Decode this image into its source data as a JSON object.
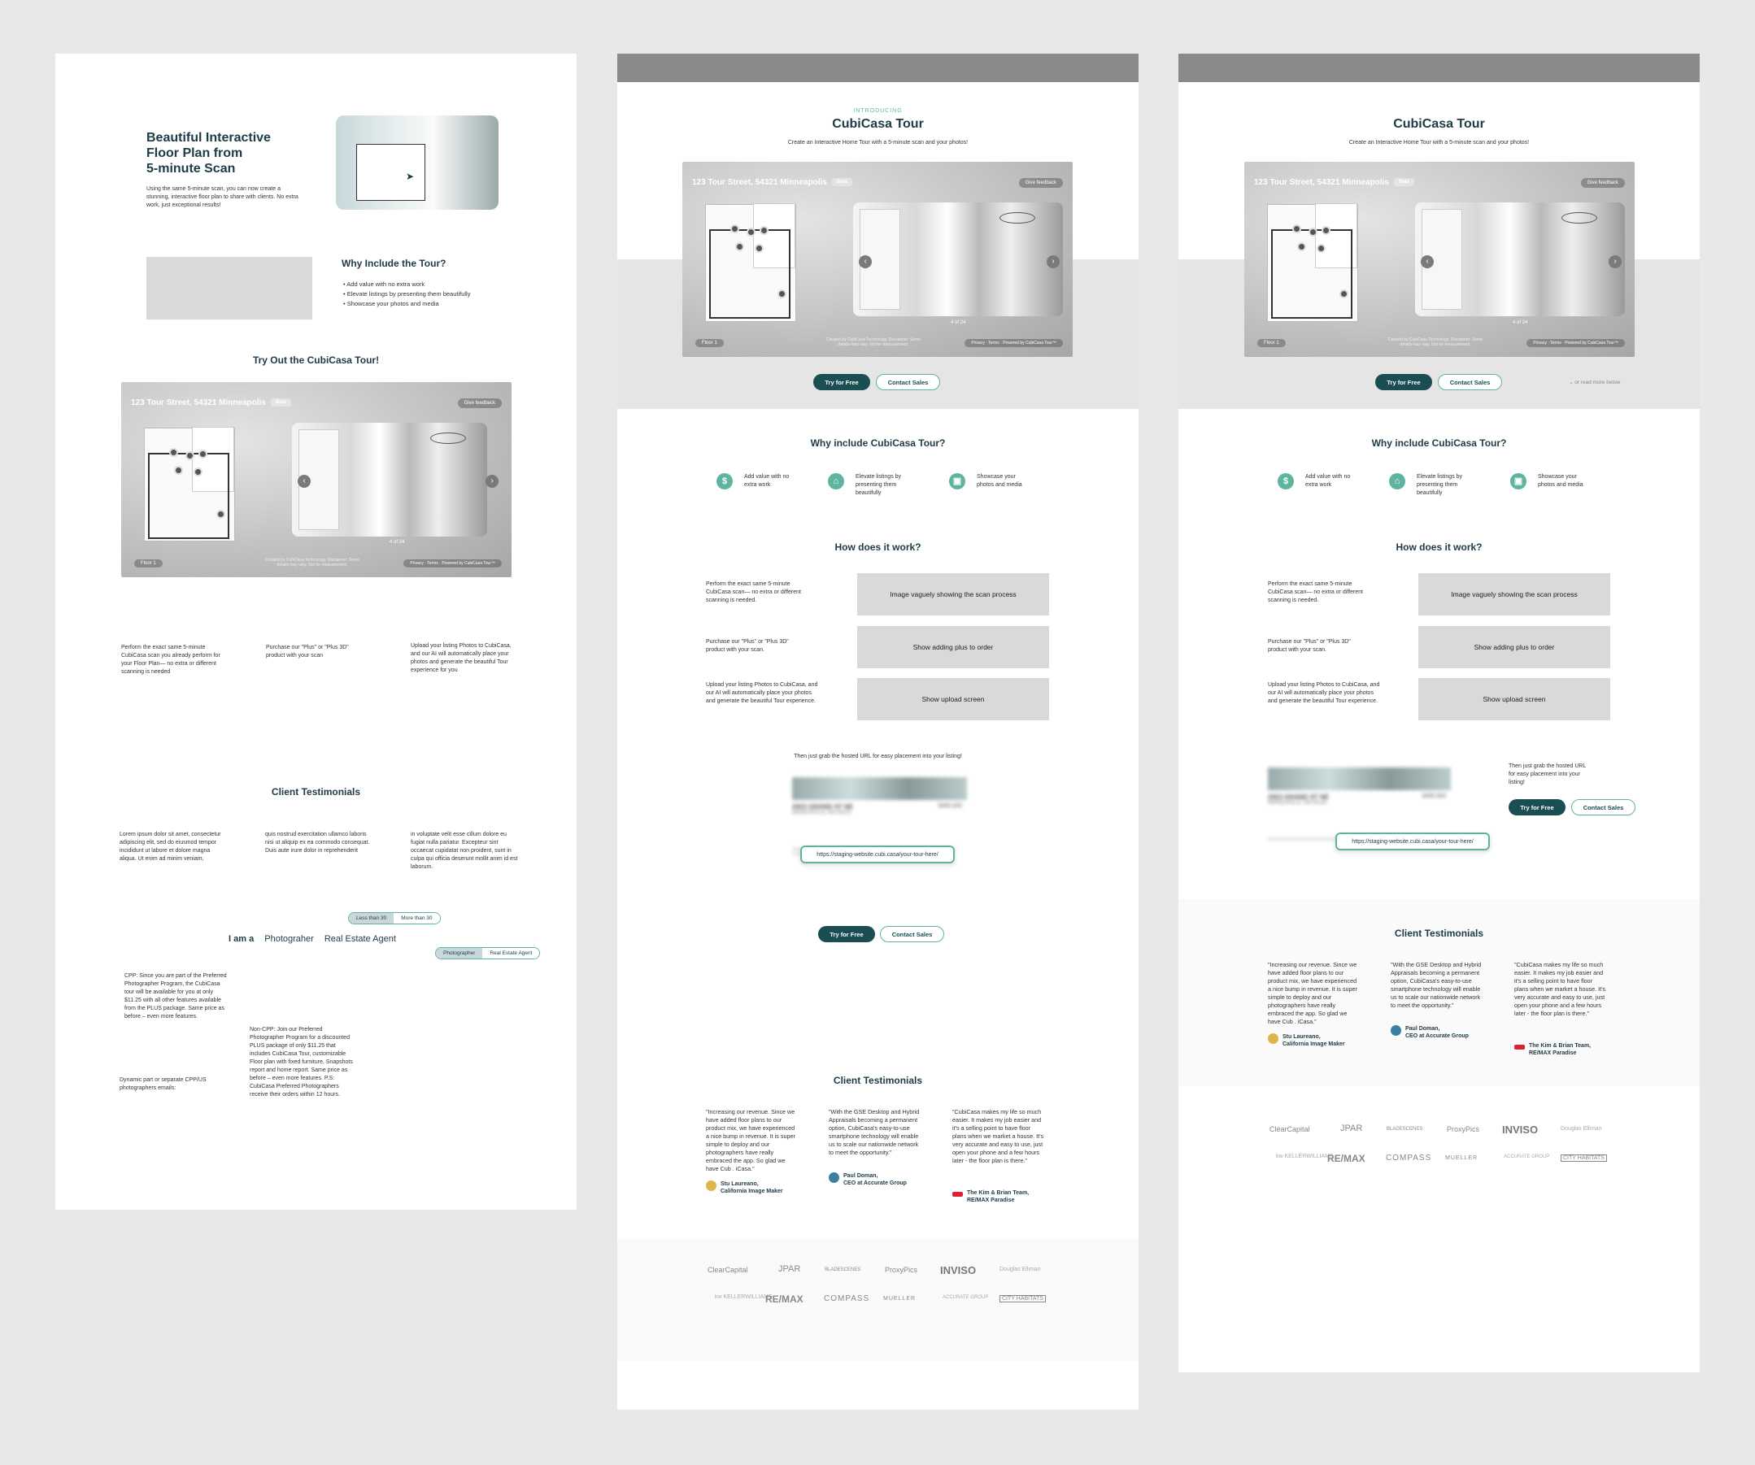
{
  "colors": {
    "primary": "#1a4e52",
    "accent": "#5fb4a0",
    "gray_box": "#d9d9d9",
    "topbar": "#8a8a8a"
  },
  "tour": {
    "address": "123 Tour Street, 54321 Minneapolis",
    "beta": "Beta",
    "feedback": "Give feedback",
    "floor": "Floor 1",
    "page": "4 of 24",
    "credit": "Created by CubiCasa Technology. Disclaimer: Some details may vary. Not for measurement.",
    "footer": "Privacy · Terms · Powered by CubiCasa Tour™"
  },
  "v1": {
    "hero_title_lines": [
      "Beautiful Interactive",
      "Floor Plan from",
      "5-minute Scan"
    ],
    "hero_body": "Using the same 5-minute scan, you can now create a stunning, interactive floor plan to share with clients. No extra work, just exceptional results!",
    "why_title": "Why Include the Tour?",
    "why_items": [
      "• Add value with no extra work",
      "• Elevate listings by presenting them beautifully",
      "• Showcase your photos and media"
    ],
    "try_title": "Try Out the CubiCasa Tour!",
    "steps": [
      "Perform the exact same 5-minute CubiCasa scan you already perform for your Floor Plan— no extra or different scanning is needed",
      "Purchase our \"Plus\" or \"Plus 3D\" product with your scan",
      "Upload your listing Photos to CubiCasa, and our AI will automatically place your photos and generate the beautiful Tour experience for you"
    ],
    "testimonials_title": "Client Testimonials",
    "lorem": [
      "Lorem ipsum dolor sit amet, consectetur adipiscing elit, sed do eiusmod tempor incididunt ut labore et dolore magna aliqua. Ut enim ad minim veniam,",
      "quis nostrud exercitation ullamco laboris nisi ut aliquip ex ea commodo consequat. Duis aute irure dolor in reprehenderit",
      "in voluptate velit esse cillum dolore eu fugiat nulla pariatur. Excepteur sint occaecat cupidatat non proident, sunt in culpa qui officia deserunt mollit anim id est laborum."
    ],
    "toggle_small": [
      "Less than 30",
      "More than 30"
    ],
    "iam": "I am a",
    "iam_options": [
      "Photograher",
      "Real Estate Agent"
    ],
    "toggle_role": [
      "Photographer",
      "Real Estate Agent"
    ],
    "cpp": "CPP: Since you are part of the Preferred Photographer Program, the CubiCasa tour will be available for you at only $11.25 with all other features available from the PLUS package. Same price as before – even more features.",
    "dynamic": "Dynamic part or separate CPP/US photographers emails:",
    "noncpp": "Non-CPP: Join our Preferred Photographer Program for a discounted PLUS package of only $11.25 that includes CubiCasa Tour, customizable Floor plan with fixed furniture, Snapshots report and home report. Same price as before – even more features. P.S: CubiCasa Preferred Photographers receive their orders within 12 hours."
  },
  "common": {
    "introducing": "INTRODUCING",
    "title": "CubiCasa Tour",
    "subtitle": "Create an Interactive Home Tour with a 5-minute scan and your photos!",
    "try_free": "Try for Free",
    "contact": "Contact Sales",
    "read_more": "⌄ or read more below",
    "why_title": "Why include CubiCasa Tour?",
    "features": [
      "Add value with no extra work",
      "Elevate listings by presenting them beautifully",
      "Showcase your photos and media"
    ],
    "how_title": "How does it work?",
    "how_steps": [
      "Perform the exact same 5-minute CubiCasa scan— no extra or different scanning is needed.",
      "Purchase our \"Plus\" or \"Plus 3D\" product with your scan.",
      "Upload your listing Photos to CubiCasa, and our AI will automatically place your photos and generate the beautiful Tour experience."
    ],
    "how_boxes": [
      "Image vaguely showing the scan process",
      "Show adding plus to order",
      "Show upload screen"
    ],
    "hosted": "Then just grab the hosted URL for easy placement into your listing!",
    "hosted_v3": "Then just grab the hosted URL for easy placement into your listing!",
    "listing_addr": "2923 GRAND ST NE",
    "listing_city": "MINNEAPOLIS, MN 55418",
    "listing_price": "$485,900",
    "url": "https://staging-website.cubi.casa/your-tour-here/",
    "testimonials_title": "Client Testimonials",
    "quotes": [
      {
        "text": "\"Increasing our revenue. Since we have added floor plans to our product mix, we have experienced a nice bump in revenue. It is super simple to deploy and our photographers have really embraced the app. So glad we have Cub . iCasa.\"",
        "name": "Stu Laureano,",
        "org": "California Image Maker"
      },
      {
        "text": "\"With the GSE Desktop and Hybrid Appraisals becoming a permanent option, CubiCasa's easy-to-use smartphone technology will enable us to scale our nationwide network to meet the opportunity.\"",
        "name": "Paul Doman,",
        "org": "CEO at Accurate Group"
      },
      {
        "text": "\"CubiCasa makes my life so much easier. It makes my job easier and it's a selling point to have floor plans when we market a house. It's very accurate and easy to use, just open your phone and a few hours later - the floor plan is there.\"",
        "name": "The Kim & Brian Team,",
        "org": "RE/MAX Paradise"
      }
    ],
    "logos_row1": [
      "ClearCapital",
      "JPAR",
      "BLADESCENES",
      "ProxyPics",
      "INVISO",
      "Douglas Elliman"
    ],
    "logos_row2": [
      "kw KELLERWILLIAMS",
      "RE/MAX",
      "COMPASS",
      "MUELLER",
      "ACCURATE GROUP",
      "CITY HABITATS"
    ]
  }
}
